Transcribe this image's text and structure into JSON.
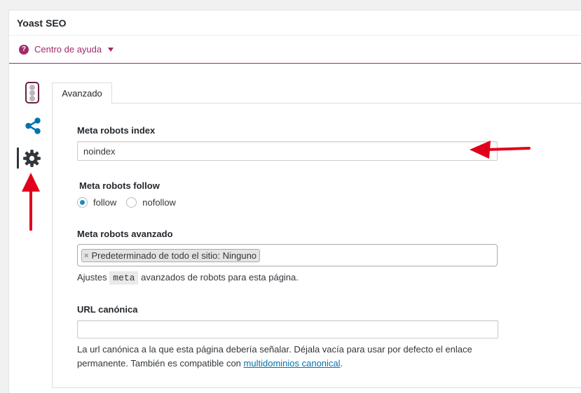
{
  "metabox": {
    "title": "Yoast SEO"
  },
  "help": {
    "label": "Centro de ayuda",
    "icon": "question-circle-icon"
  },
  "side_nav": {
    "items": [
      {
        "name": "readability-traffic-light",
        "icon": "traffic-light-icon"
      },
      {
        "name": "social",
        "icon": "share-icon",
        "color": "#0073aa"
      },
      {
        "name": "advanced",
        "icon": "gear-icon",
        "active": true
      }
    ]
  },
  "tab": {
    "label": "Avanzado"
  },
  "fields": {
    "robots_index": {
      "label": "Meta robots index",
      "value": "noindex"
    },
    "robots_follow": {
      "label": "Meta robots follow",
      "options": [
        {
          "label": "follow",
          "checked": true
        },
        {
          "label": "nofollow",
          "checked": false
        }
      ]
    },
    "robots_advanced": {
      "label": "Meta robots avanzado",
      "chip_label": "Predeterminado de todo el sitio: Ninguno",
      "help_prefix": "Ajustes",
      "help_code": "meta",
      "help_suffix": "avanzados de robots para esta página."
    },
    "canonical": {
      "label": "URL canónica",
      "value": "",
      "help_line1": "La url canónica a la que esta página debería señalar. Déjala vacía para usar por defecto el enlace",
      "help_line2_prefix": "permanente. También es compatible con",
      "help_link": "multidominios canonical",
      "help_line2_suffix": "."
    }
  },
  "colors": {
    "yoast_purple": "#a4286a",
    "wp_blue": "#0073aa",
    "arrow_red": "#e0001b"
  }
}
